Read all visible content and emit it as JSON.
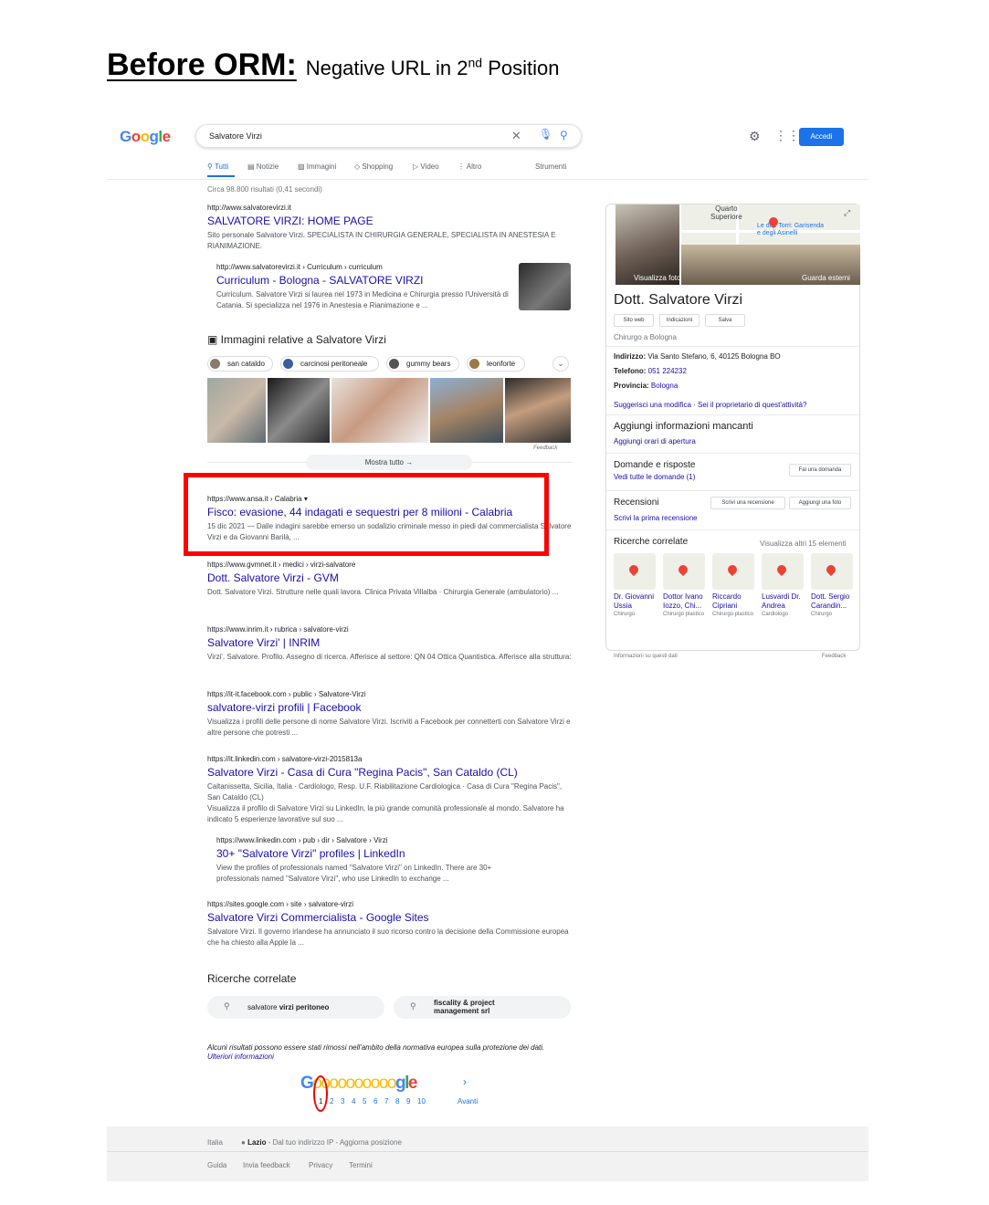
{
  "heading": {
    "title": "Before ORM:",
    "subtitle_pre": "Negative URL in 2",
    "subtitle_sup": "nd",
    "subtitle_post": " Position"
  },
  "google": {
    "logo": [
      "G",
      "o",
      "o",
      "g",
      "l",
      "e"
    ],
    "search_value": "Salvatore Virzi",
    "login_label": "Accedi"
  },
  "tabs": {
    "all": "Tutti",
    "news": "Notizie",
    "images": "Immagini",
    "shopping": "Shopping",
    "video": "Video",
    "more": "Altro",
    "tools": "Strumenti"
  },
  "result_stats": "Circa 98.800 risultati (0,41 secondi)",
  "results": [
    {
      "url": "http://www.salvatorevirzi.it",
      "title": "SALVATORE VIRZI: HOME PAGE",
      "snippet": "Sito personale Salvatore Virzi. SPECIALISTA IN CHIRURGIA GENERALE, SPECIALISTA IN ANESTESIA E RIANIMAZIONE."
    },
    {
      "url": "https://www.ansa.it › Calabria",
      "title": "Fisco: evasione, 44 indagati e sequestri per 8 milioni - Calabria",
      "snippet": "15 dic 2021 — Dalle indagini sarebbe emerso un sodalizio criminale messo in piedi dal commercialista Salvatore Virzi e da Giovanni Barilà, ..."
    },
    {
      "url": "https://www.gvmnet.it › medici › virzi-salvatore",
      "title": "Dott. Salvatore Virzi - GVM",
      "snippet": "Dott. Salvatore Virzi. Strutture nelle quali lavora. Clinica Privata Villalba · Chirurgia Generale (ambulatorio) ..."
    },
    {
      "url": "https://www.inrim.it › rubrica › salvatore-virzi",
      "title": "Salvatore Virzi' | INRIM",
      "snippet": "Virzi'. Salvatore. Profilo. Assegno di ricerca. Afferisce al settore: QN 04 Ottica Quantistica. Afferisce alla struttura:"
    },
    {
      "url": "https://it-it.facebook.com › public › Salvatore-Virzi",
      "title": "salvatore-virzi profili | Facebook",
      "snippet": "Visualizza i profili delle persone di nome Salvatore Virzi. Iscriviti a Facebook per connetterti con Salvatore Virzi e altre persone che potresti ..."
    },
    {
      "url": "https://it.linkedin.com › salvatore-virzi-2015813a",
      "title": "Salvatore Virzi - Casa di Cura \"Regina Pacis\", San Cataldo (CL)",
      "snippet": "Caltanissetta, Sicilia, Italia · Cardiologo, Resp. U.F. Riabilitazione Cardiologica · Casa di Cura \"Regina Pacis\", San Cataldo (CL)",
      "snippet2": "Visualizza il profilo di Salvatore Virzi su LinkedIn, la più grande comunità professionale al mondo. Salvatore ha indicato 5 esperienze lavorative sul suo ..."
    },
    {
      "url": "https://sites.google.com › site › salvatore-virzi",
      "title": "Salvatore Virzi Commercialista - Google Sites",
      "snippet": "Salvatore Virzi. Il governo irlandese ha annunciato il suo ricorso contro la decisione della Commissione europea che ha chiesto alla Apple la ..."
    }
  ],
  "sub_results": [
    {
      "url": "http://www.salvatorevirzi.it › Curriculum › curriculum",
      "title": "Curriculum - Bologna - SALVATORE VIRZI",
      "snippet": "Curriculum. Salvatore Virzi si laurea nel 1973 in Medicina e Chirurgia presso l'Università di Catania. Si specializza nel 1976 in Anestesia e Rianimazione e ..."
    },
    {
      "url": "https://www.linkedin.com › pub › dir › Salvatore › Virzi",
      "title": "30+ \"Salvatore Virzi\" profiles | LinkedIn",
      "snippet": "View the profiles of professionals named \"Salvatore Virzi\" on LinkedIn. There are 30+ professionals named \"Salvatore Virzi\", who use LinkedIn to exchange ..."
    }
  ],
  "images": {
    "heading": "Immagini relative a Salvatore Virzi",
    "chips": [
      "san cataldo",
      "carcinosi peritoneale",
      "gummy bears",
      "leonforte"
    ],
    "feedback": "Feedback",
    "show_all": "Mostra tutto"
  },
  "related": {
    "heading": "Ricerche correlate",
    "chip1_pre": "salvatore ",
    "chip1_bold": "virzi peritoneo",
    "chip2_line1": "fiscality & project",
    "chip2_line2": "management srl"
  },
  "removed_notice": "Alcuni risultati possono essere stati rimossi nell'ambito della normativa europea sulla protezione dei dati.",
  "removed_link": "Ulteriori informazioni",
  "pager": {
    "logo_first": "G",
    "logo_os": "oooooooooo",
    "logo_end_g": "g",
    "logo_end_l": "l",
    "logo_end_e": "e",
    "pages": [
      "1",
      "2",
      "3",
      "4",
      "5",
      "6",
      "7",
      "8",
      "9",
      "10"
    ],
    "next": "Avanti"
  },
  "footer": {
    "country": "Italia",
    "region": "Lazio",
    "location_text": " - Dal tuo indirizzo IP - Aggiorna posizione",
    "links": [
      "Guida",
      "Invia feedback",
      "Privacy",
      "Termini"
    ]
  },
  "knowledge_panel": {
    "map_label1_a": "Quarto",
    "map_label1_b": "Superiore",
    "map_label2_a": "Le due Torri: Garisenda",
    "map_label2_b": "e degli Asinelli",
    "see_photos": "Visualizza foto",
    "see_outside": "Guarda esterni",
    "name": "Dott. Salvatore Virzi",
    "buttons": [
      "Sito web",
      "Indicazioni",
      "Salva"
    ],
    "category": "Chirurgo a Bologna",
    "address_label": "Indirizzo:",
    "address": " Via Santo Stefano, 6, 40125 Bologna BO",
    "phone_label": "Telefono:",
    "phone": "051 224232",
    "province_label": "Provincia:",
    "province": "Bologna",
    "suggest_edit": "Suggerisci una modifica",
    "owner": "Sei il proprietario di quest'attività?",
    "add_info": "Aggiungi informazioni mancanti",
    "add_hours": "Aggiungi orari di apertura",
    "qa_heading": "Domande e risposte",
    "qa_see_all": "Vedi tutte le domande (1)",
    "qa_ask": "Fai una domanda",
    "reviews_heading": "Recensioni",
    "write_review": "Scrivi una recensione",
    "add_photo": "Aggiungi una foto",
    "first_review": "Scrivi la prima recensione",
    "related_heading": "Ricerche correlate",
    "related_more": "Visualizza altri 15 elementi",
    "related": [
      {
        "name": "Dr. Giovanni Ussia",
        "spec": "Chirurgo"
      },
      {
        "name": "Dottor Ivano Iozzo, Chi...",
        "spec": "Chirurgo plastico"
      },
      {
        "name": "Riccardo Cipriani",
        "spec": "Chirurgo plastico"
      },
      {
        "name": "Lusvardi Dr. Andrea",
        "spec": "Cardiologo"
      },
      {
        "name": "Dott. Sergio Carandin...",
        "spec": "Chirurgo"
      }
    ],
    "about": "Informazioni su questi dati",
    "feedback": "Feedback"
  },
  "colors": {
    "highlight": "#ff0000",
    "link": "#1a0dab",
    "accent": "#1a73e8"
  }
}
